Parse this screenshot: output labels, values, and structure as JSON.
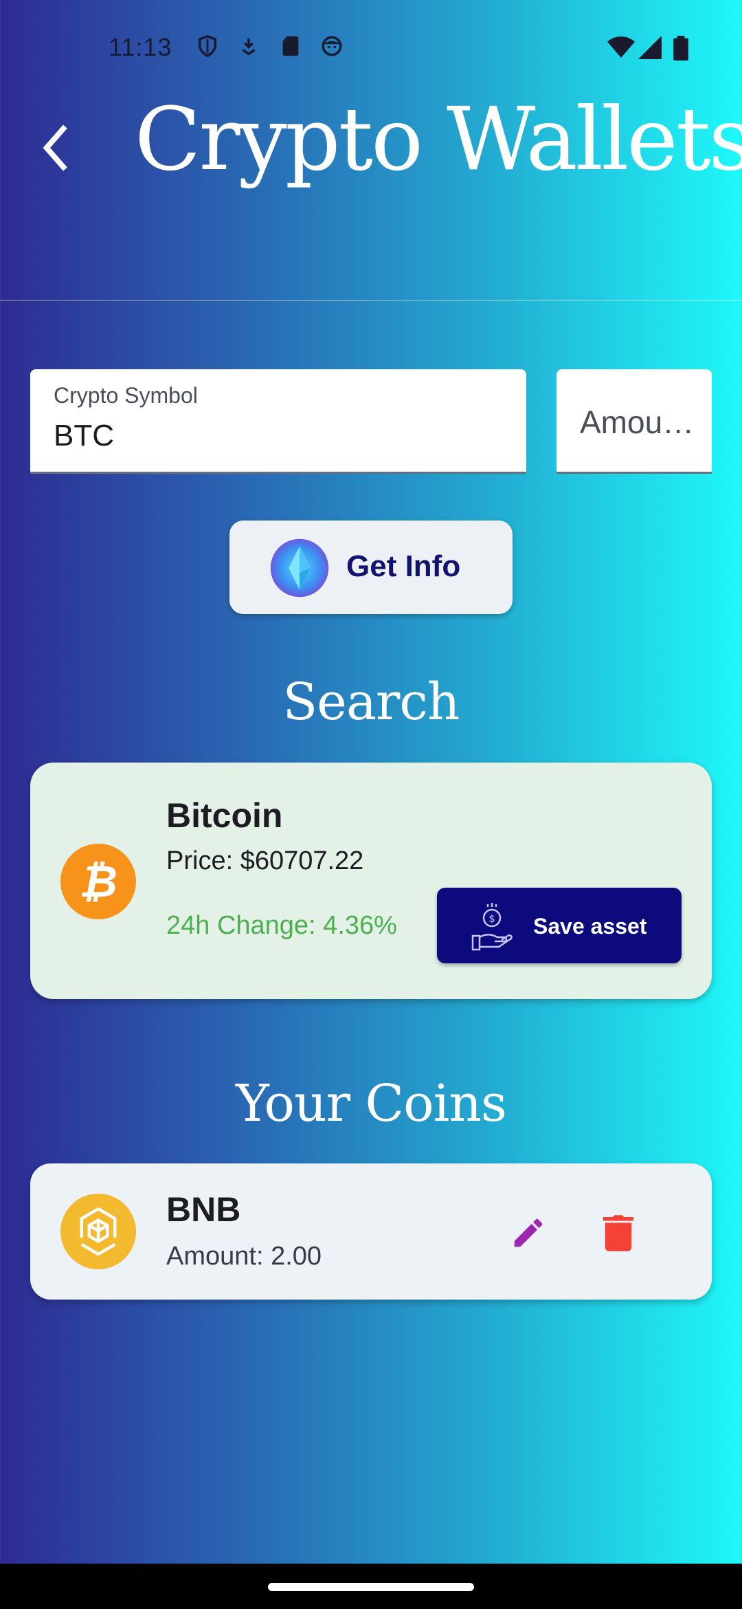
{
  "status_bar": {
    "time": "11:13",
    "icons_left": [
      "shield-icon",
      "download-icon",
      "sd-card-icon",
      "face-icon"
    ],
    "icons_right": [
      "wifi-icon",
      "signal-icon",
      "battery-icon"
    ]
  },
  "app_bar": {
    "title": "Crypto Wallets",
    "back_icon": "chevron-left-icon"
  },
  "form": {
    "symbol_label": "Crypto Symbol",
    "symbol_value": "BTC",
    "amount_placeholder": "Amou…",
    "get_info_label": "Get Info"
  },
  "search": {
    "section_title": "Search",
    "result": {
      "name": "Bitcoin",
      "price": "Price: $60707.22",
      "change": "24h Change: 4.36%",
      "change_color": "#4caf50",
      "save_label": "Save asset"
    }
  },
  "coins": {
    "section_title": "Your Coins",
    "items": [
      {
        "symbol": "BNB",
        "amount": "Amount: 2.00"
      }
    ]
  },
  "colors": {
    "accent_dark": "#0c0a7d",
    "edit": "#9c27b0",
    "delete": "#f44336",
    "bitcoin": "#f7931a",
    "bnb": "#f3ba2f"
  }
}
